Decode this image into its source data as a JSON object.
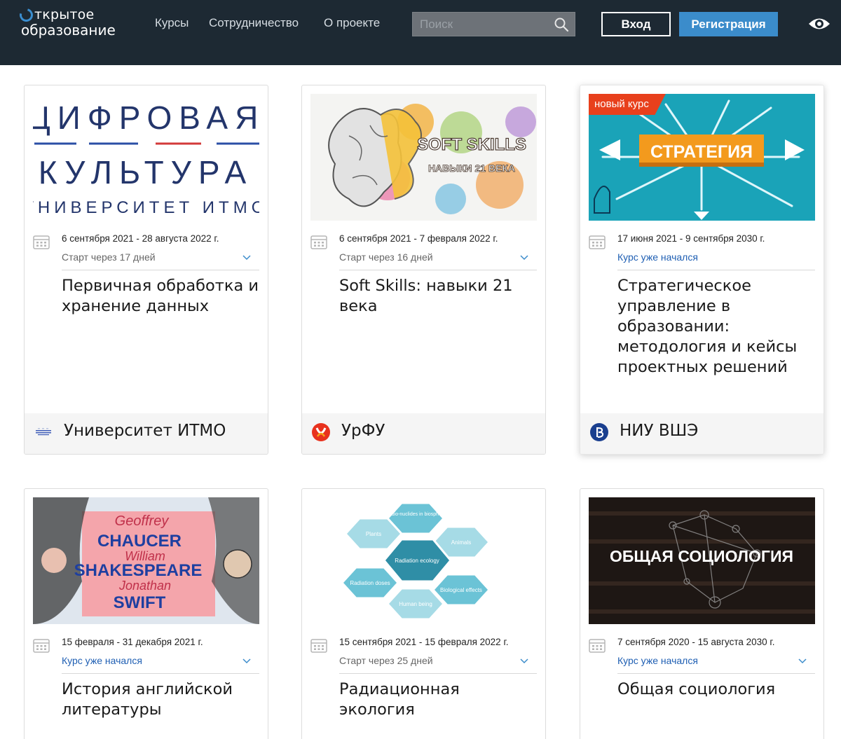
{
  "header": {
    "logo_line1": "ткрытое",
    "logo_line2": "образование",
    "nav": [
      "Курсы",
      "Сотрудничество",
      "О проекте"
    ],
    "search_placeholder": "Поиск",
    "login_label": "Вход",
    "register_label": "Регистрация"
  },
  "colors": {
    "header_bg": "#1d2933",
    "accent": "#3b8ccb",
    "live_status": "#1f5fb3",
    "badge": "#e8401c"
  },
  "cards": [
    {
      "thumb_lines": [
        "ЦИФРОВАЯ",
        "КУЛЬТУРА",
        "УНИВЕРСИТЕТ ИТМО"
      ],
      "dates": "6 сентября 2021 - 28 августа 2022 г.",
      "status": "Старт через 17 дней",
      "title": "Первичная обработка и хранение данных",
      "university": "Университет ИТМО"
    },
    {
      "thumb_lines": [
        "SOFT SKILLS",
        "НАВЫКИ 21 ВЕКА"
      ],
      "dates": "6 сентября 2021 - 7 февраля 2022 г.",
      "status": "Старт через 16 дней",
      "title": "Soft Skills: навыки 21 века",
      "university": "УрФУ"
    },
    {
      "badge": "новый курс",
      "thumb_lines": [
        "СТРАТЕГИЯ"
      ],
      "dates": "17 июня 2021 - 9 сентября 2030 г.",
      "status": "Курс уже начался",
      "title": "Стратегическое управление в образовании: методология и кейсы проектных решений",
      "university": "НИУ ВШЭ"
    },
    {
      "thumb_lines": [
        "Geoffrey",
        "CHAUCER",
        "William",
        "SHAKESPEARE",
        "Jonathan",
        "SWIFT"
      ],
      "dates": "15 февраля - 31 декабря 2021 г.",
      "status": "Курс уже начался",
      "title": "История английской литературы"
    },
    {
      "thumb_lines": [
        "Radio-nuclides in biosphere",
        "Plants",
        "Animals",
        "Radiation ecology",
        "Radiation doses",
        "Biological effects",
        "Human being"
      ],
      "dates": "15 сентября 2021 - 15 февраля 2022 г.",
      "status": "Старт через 25 дней",
      "title": "Радиационная экология"
    },
    {
      "thumb_lines": [
        "ОБЩАЯ СОЦИОЛОГИЯ"
      ],
      "dates": "7 сентября 2020 - 15 августа 2030 г.",
      "status": "Курс уже начался",
      "title": "Общая социология"
    }
  ]
}
